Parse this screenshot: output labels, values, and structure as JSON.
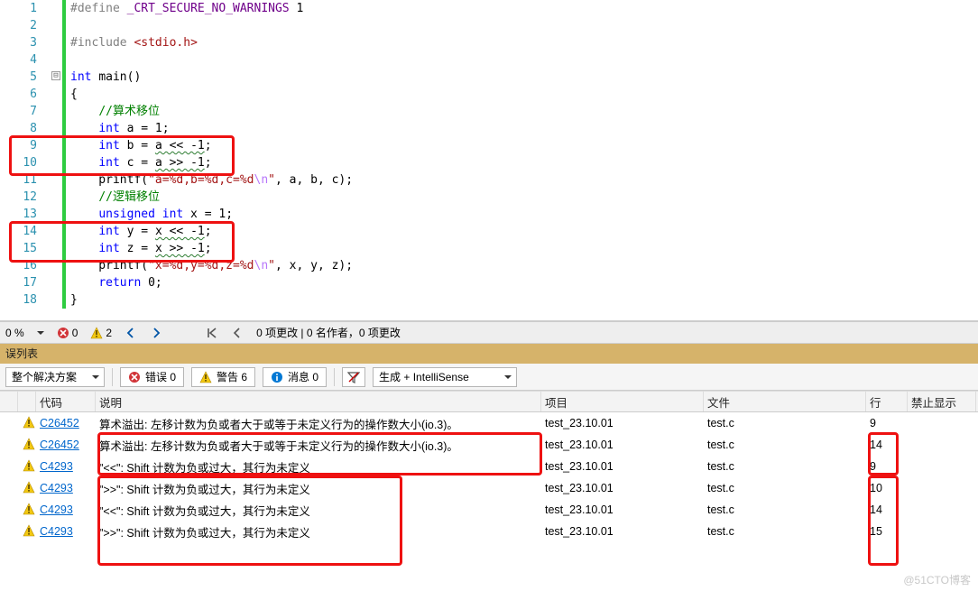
{
  "code": {
    "lines": [
      {
        "n": 1,
        "tokens": [
          [
            "pre",
            "#define "
          ],
          [
            "mac",
            "_CRT_SECURE_NO_WARNINGS"
          ],
          [
            "pln",
            " 1"
          ]
        ]
      },
      {
        "n": 2,
        "tokens": []
      },
      {
        "n": 3,
        "tokens": [
          [
            "pre",
            "#include "
          ],
          [
            "inc",
            "<stdio.h>"
          ]
        ]
      },
      {
        "n": 4,
        "tokens": []
      },
      {
        "n": 5,
        "tokens": [
          [
            "type",
            "int"
          ],
          [
            "pln",
            " "
          ],
          [
            "pln",
            "main()"
          ]
        ]
      },
      {
        "n": 6,
        "tokens": [
          [
            "pln",
            "{"
          ]
        ]
      },
      {
        "n": 7,
        "tokens": [
          [
            "pln",
            "    "
          ],
          [
            "com",
            "//算术移位"
          ]
        ]
      },
      {
        "n": 8,
        "tokens": [
          [
            "pln",
            "    "
          ],
          [
            "type",
            "int"
          ],
          [
            "pln",
            " a = 1;"
          ]
        ]
      },
      {
        "n": 9,
        "tokens": [
          [
            "pln",
            "    "
          ],
          [
            "type",
            "int"
          ],
          [
            "pln",
            " b = "
          ],
          [
            "sq",
            "a << -1"
          ],
          [
            "pln",
            ";"
          ]
        ]
      },
      {
        "n": 10,
        "tokens": [
          [
            "pln",
            "    "
          ],
          [
            "type",
            "int"
          ],
          [
            "pln",
            " c = "
          ],
          [
            "sq",
            "a >> -1"
          ],
          [
            "pln",
            ";"
          ]
        ]
      },
      {
        "n": 11,
        "tokens": [
          [
            "pln",
            "    printf("
          ],
          [
            "str",
            "\"a=%d,b=%d,c=%d"
          ],
          [
            "esc",
            "\\n"
          ],
          [
            "str",
            "\""
          ],
          [
            "pln",
            ", a, b, c);"
          ]
        ]
      },
      {
        "n": 12,
        "tokens": [
          [
            "pln",
            "    "
          ],
          [
            "com",
            "//逻辑移位"
          ]
        ]
      },
      {
        "n": 13,
        "tokens": [
          [
            "pln",
            "    "
          ],
          [
            "type",
            "unsigned int"
          ],
          [
            "pln",
            " x = 1;"
          ]
        ]
      },
      {
        "n": 14,
        "tokens": [
          [
            "pln",
            "    "
          ],
          [
            "type",
            "int"
          ],
          [
            "pln",
            " y = "
          ],
          [
            "sq",
            "x << -1"
          ],
          [
            "pln",
            ";"
          ]
        ]
      },
      {
        "n": 15,
        "tokens": [
          [
            "pln",
            "    "
          ],
          [
            "type",
            "int"
          ],
          [
            "pln",
            " z = "
          ],
          [
            "sq",
            "x >> -1"
          ],
          [
            "pln",
            ";"
          ]
        ]
      },
      {
        "n": 16,
        "tokens": [
          [
            "pln",
            "    printf("
          ],
          [
            "str",
            "\"x=%d,y=%d,z=%d"
          ],
          [
            "esc",
            "\\n"
          ],
          [
            "str",
            "\""
          ],
          [
            "pln",
            ", x, y, z);"
          ]
        ]
      },
      {
        "n": 17,
        "tokens": [
          [
            "pln",
            "    "
          ],
          [
            "key",
            "return"
          ],
          [
            "pln",
            " 0;"
          ]
        ]
      },
      {
        "n": 18,
        "tokens": [
          [
            "pln",
            "}"
          ]
        ]
      }
    ],
    "outline_minus": "⊟"
  },
  "statusStrip": {
    "zoom": "0 %",
    "noIssues": "0",
    "warnGlyphCount": "2",
    "changes_text": "0 项更改 | 0 名作者，0 项更改"
  },
  "errorList": {
    "panelTitle": "误列表",
    "scopeDropdown": "整个解决方案",
    "errorsLabel": "错误 0",
    "warningsLabel": "警告 6",
    "messagesLabel": "消息 0",
    "buildDropdown": "生成 + IntelliSense",
    "columns": {
      "icon": "",
      "icon2": "",
      "code": "代码",
      "desc": "说明",
      "project": "项目",
      "file": "文件",
      "line": "行",
      "suppress": "禁止显示"
    },
    "rows": [
      {
        "code": "C26452",
        "desc": "算术溢出: 左移计数为负或者大于或等于未定义行为的操作数大小(io.3)。",
        "project": "test_23.10.01",
        "file": "test.c",
        "line": "9"
      },
      {
        "code": "C26452",
        "desc": "算术溢出: 左移计数为负或者大于或等于未定义行为的操作数大小(io.3)。",
        "project": "test_23.10.01",
        "file": "test.c",
        "line": "14"
      },
      {
        "code": "C4293",
        "desc": "\"<<\": Shift 计数为负或过大，其行为未定义",
        "project": "test_23.10.01",
        "file": "test.c",
        "line": "9"
      },
      {
        "code": "C4293",
        "desc": "\">>\": Shift 计数为负或过大，其行为未定义",
        "project": "test_23.10.01",
        "file": "test.c",
        "line": "10"
      },
      {
        "code": "C4293",
        "desc": "\"<<\": Shift 计数为负或过大，其行为未定义",
        "project": "test_23.10.01",
        "file": "test.c",
        "line": "14"
      },
      {
        "code": "C4293",
        "desc": "\">>\": Shift 计数为负或过大，其行为未定义",
        "project": "test_23.10.01",
        "file": "test.c",
        "line": "15"
      }
    ]
  },
  "watermark": "@51CTO博客"
}
